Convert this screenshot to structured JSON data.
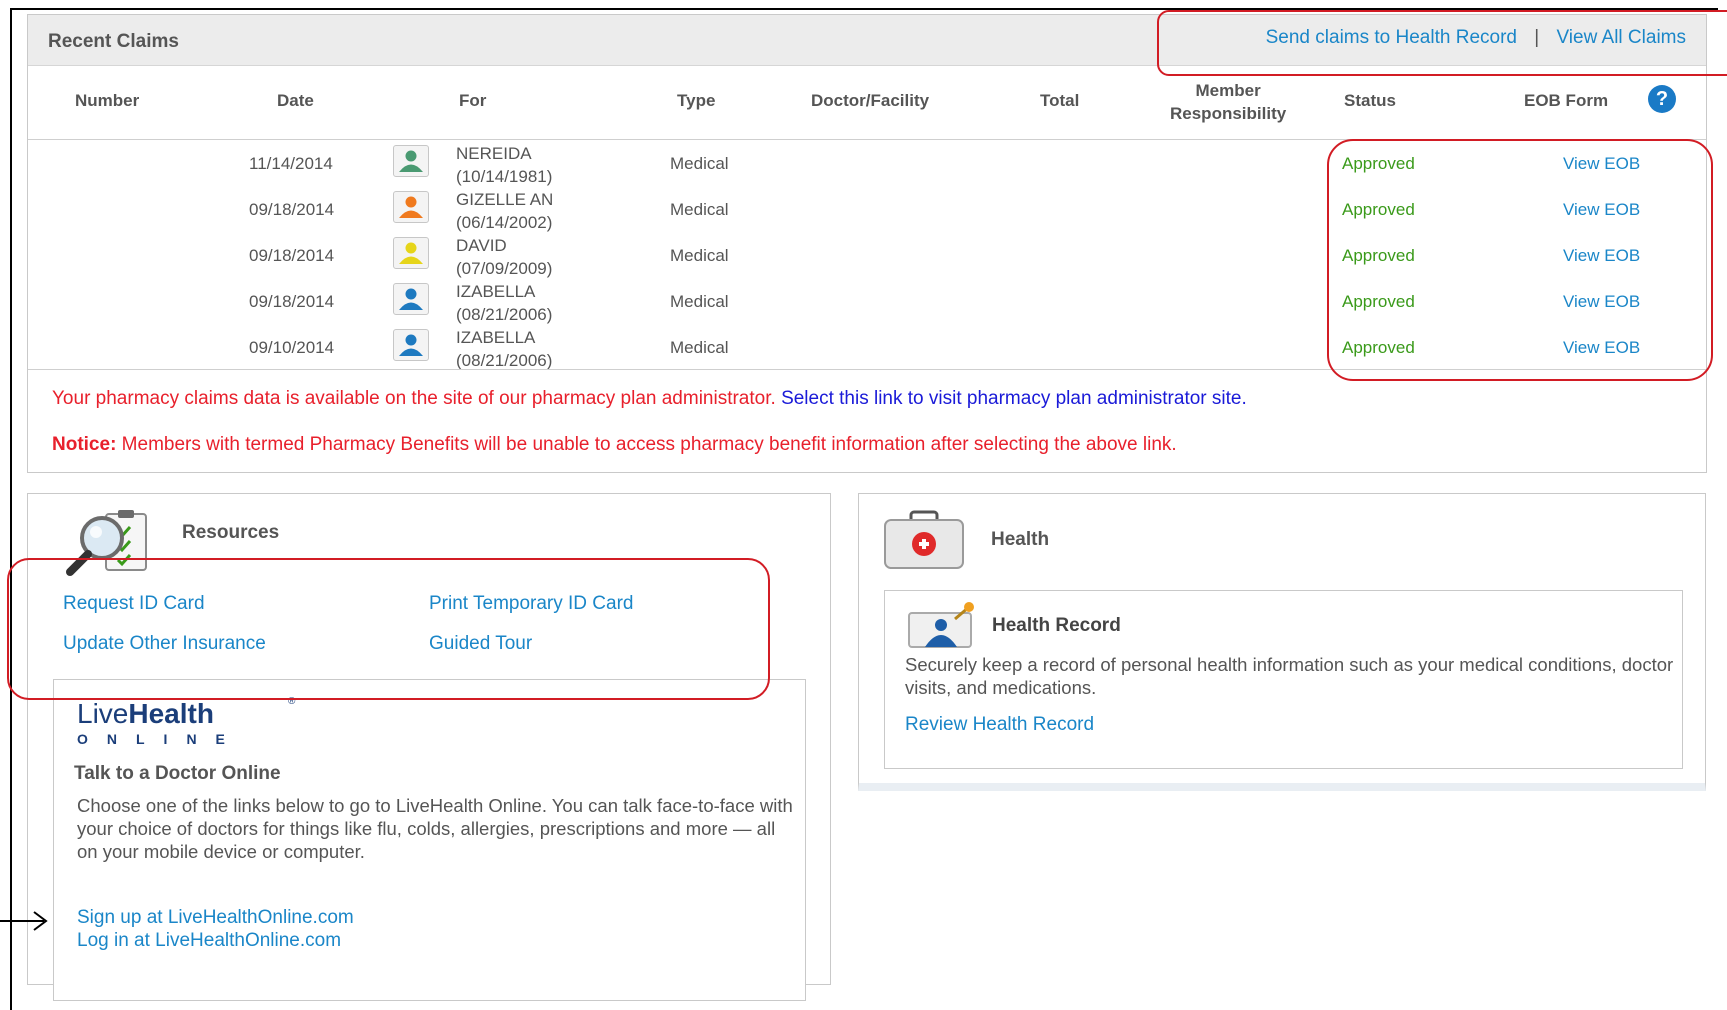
{
  "claims": {
    "title": "Recent Claims",
    "send_link": "Send claims to Health Record",
    "separator": "|",
    "view_all_link": "View All Claims",
    "columns": {
      "number": "Number",
      "date": "Date",
      "for": "For",
      "type": "Type",
      "doctor": "Doctor/Facility",
      "total": "Total",
      "member_line1": "Member",
      "member_line2": "Responsibility",
      "status": "Status",
      "eob": "EOB Form"
    },
    "rows": [
      {
        "date": "11/14/2014",
        "name": "NEREIDA",
        "dob": "(10/14/1981)",
        "type": "Medical",
        "status": "Approved",
        "eob": "View EOB",
        "avatar_color": "#4a9a72"
      },
      {
        "date": "09/18/2014",
        "name": "GIZELLE AN",
        "dob": "(06/14/2002)",
        "type": "Medical",
        "status": "Approved",
        "eob": "View EOB",
        "avatar_color": "#f07a1e"
      },
      {
        "date": "09/18/2014",
        "name": "DAVID",
        "dob": "(07/09/2009)",
        "type": "Medical",
        "status": "Approved",
        "eob": "View EOB",
        "avatar_color": "#e6d51a"
      },
      {
        "date": "09/18/2014",
        "name": "IZABELLA",
        "dob": "(08/21/2006)",
        "type": "Medical",
        "status": "Approved",
        "eob": "View EOB",
        "avatar_color": "#1e7ac0"
      },
      {
        "date": "09/10/2014",
        "name": "IZABELLA",
        "dob": "(08/21/2006)",
        "type": "Medical",
        "status": "Approved",
        "eob": "View EOB",
        "avatar_color": "#1e7ac0"
      }
    ],
    "pharmacy_text": "Your pharmacy claims data is available on the site of our pharmacy plan administrator. ",
    "pharmacy_link": "Select this link to visit pharmacy plan administrator site.",
    "notice_label": "Notice:",
    "notice_text": " Members with termed Pharmacy Benefits will be unable to access pharmacy benefit information after selecting the above link."
  },
  "resources": {
    "title": "Resources",
    "request_id": "Request ID Card",
    "print_temp": "Print Temporary ID Card",
    "update_ins": "Update Other Insurance",
    "guided_tour": "Guided Tour"
  },
  "livehealth": {
    "logo_live": "Live",
    "logo_health": "Health",
    "logo_reg": "®",
    "logo_online": "ONLINE",
    "heading": "Talk to a Doctor Online",
    "description": "Choose one of the links below to go to LiveHealth Online. You can talk face-to-face with your choice of doctors for things like flu, colds, allergies, prescriptions and more — all on your mobile device or computer.",
    "signup": "Sign up at LiveHealthOnline.com",
    "login": "Log in at LiveHealthOnline.com"
  },
  "health": {
    "title": "Health",
    "record_title": "Health Record",
    "record_desc": "Securely keep a record of personal health information such as your medical conditions, doctor visits, and medications.",
    "review_link": "Review Health Record"
  },
  "colors": {
    "link": "#1a86c8",
    "approved": "#3a9a1a",
    "alert": "#e8202c",
    "annotation": "#d21c24"
  }
}
